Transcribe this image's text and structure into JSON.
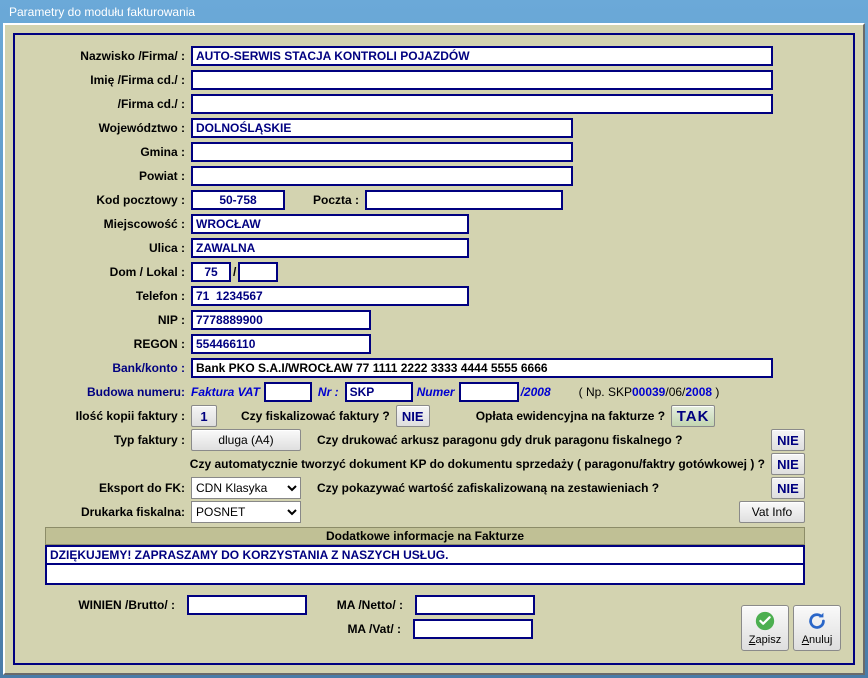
{
  "window": {
    "title": "Parametry do modułu fakturowania"
  },
  "labels": {
    "nazwisko": "Nazwisko /Firma/ :",
    "imie": "Imię /Firma cd./ :",
    "firma_cd": "/Firma cd./ :",
    "wojewodztwo": "Województwo :",
    "gmina": "Gmina :",
    "powiat": "Powiat :",
    "kod": "Kod pocztowy :",
    "poczta": "Poczta :",
    "miejsc": "Miejscowość :",
    "ulica": "Ulica :",
    "dom": "Dom / Lokal :",
    "slash": "/",
    "telefon": "Telefon :",
    "nip": "NIP :",
    "regon": "REGON :",
    "bank": "Bank/konto :",
    "budowa": "Budowa numeru:",
    "faktura_vat": "Faktura VAT",
    "nr": "Nr :",
    "numer": "Numer",
    "rok": "/2008",
    "np_prefix": "( Np. SKP",
    "np_num": "00039",
    "np_mid": "/06/",
    "np_year": "2008",
    "np_suffix": " )",
    "ilosc": "Ilość kopii faktury :",
    "fiskal_q": "Czy fiskalizować faktury ?",
    "oplata_q": "Opłata ewidencyjna na fakturze ?",
    "typ": "Typ faktury :",
    "paragon_q": "Czy drukować arkusz paragonu gdy druk paragonu fiskalnego ?",
    "kp_q": "Czy automatycznie tworzyć dokument KP do dokumentu sprzedaży ( paragonu/faktry gotówkowej ) ?",
    "eksport": "Eksport do FK:",
    "zestaw_q": "Czy pokazywać wartość zafiskalizowaną na zestawieniach       ?",
    "drukarka": "Drukarka fiskalna:",
    "vatinfo": "Vat Info",
    "dodatkowe": "Dodatkowe informacje na Fakturze",
    "winien": "WINIEN /Brutto/ :",
    "manetto": "MA /Netto/ :",
    "mavat": "MA /Vat/ :",
    "zapisz": "Zapisz",
    "anuluj": "Anuluj"
  },
  "values": {
    "nazwisko": "AUTO-SERWIS STACJA KONTROLI POJAZDÓW",
    "imie": "",
    "firma_cd": "",
    "wojewodztwo": "DOLNOŚLĄSKIE",
    "gmina": "",
    "powiat": "",
    "kod": "50-758",
    "poczta": "",
    "miejsc": "WROCŁAW",
    "ulica": "ZAWALNA",
    "dom": "75",
    "lokal": "",
    "telefon": "71  1234567",
    "nip": "7778889900",
    "regon": "554466110",
    "bank": "Bank PKO S.A.I/WROCŁAW 77 1111 2222 3333 4444 5555 6666",
    "budowa_prefix": "",
    "nr_value": "SKP",
    "numer_value": "",
    "ilosc_kopii": "1",
    "nie": "NIE",
    "tak": "TAK",
    "typ_faktury": "dluga (A4)",
    "eksport_fk": "CDN Klasyka",
    "drukarka_fisk": "POSNET",
    "note1": "DZIĘKUJEMY! ZAPRASZAMY DO KORZYSTANIA Z NASZYCH USŁUG.",
    "note2": "",
    "winien": "",
    "manetto": "",
    "mavat": ""
  }
}
